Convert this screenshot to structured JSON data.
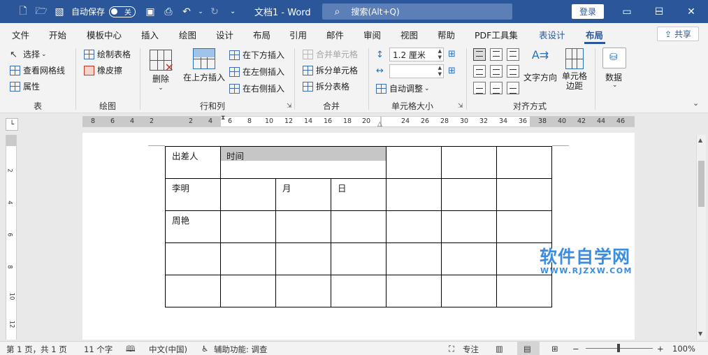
{
  "titlebar": {
    "autosave_label": "自动保存",
    "autosave_state": "关",
    "doc_title": "文档1  -  Word",
    "search_placeholder": "搜索(Alt+Q)",
    "login_label": "登录",
    "minimize": "─",
    "maximize": "☐",
    "close": "✕"
  },
  "tabs": [
    "文件",
    "开始",
    "模板中心",
    "插入",
    "绘图",
    "设计",
    "布局",
    "引用",
    "邮件",
    "审阅",
    "视图",
    "帮助",
    "PDF工具集",
    "表设计",
    "布局"
  ],
  "share_label": "共享",
  "ribbon": {
    "table_group": {
      "label": "表",
      "select": "选择",
      "view_gridlines": "查看网格线",
      "properties": "属性"
    },
    "draw_group": {
      "label": "绘图",
      "draw_table": "绘制表格",
      "eraser": "橡皮擦"
    },
    "rows_cols_group": {
      "label": "行和列",
      "delete": "删除",
      "insert_above": "在上方插入",
      "insert_below": "在下方插入",
      "insert_left": "在左侧插入",
      "insert_right": "在右侧插入"
    },
    "merge_group": {
      "label": "合并",
      "merge_cells": "合并单元格",
      "split_cells": "拆分单元格",
      "split_table": "拆分表格"
    },
    "cell_size_group": {
      "label": "单元格大小",
      "height_value": "1.2 厘米",
      "width_value": "",
      "autofit": "自动调整"
    },
    "align_group": {
      "label": "对齐方式",
      "text_direction": "文字方向",
      "cell_margins": "单元格\n边距"
    },
    "data_group": {
      "label": "数据"
    }
  },
  "ruler": {
    "numbers": [
      "8",
      "6",
      "4",
      "2",
      "2",
      "4",
      "6",
      "8",
      "10",
      "12",
      "14",
      "16",
      "18",
      "20",
      "24",
      "26",
      "28",
      "30",
      "32",
      "34",
      "36",
      "38",
      "40",
      "42",
      "44",
      "46"
    ],
    "vnumbers": [
      "2",
      "4",
      "6",
      "8",
      "10",
      "12"
    ]
  },
  "table": {
    "rows": [
      [
        "出差人",
        "时间",
        "",
        "",
        "",
        "",
        ""
      ],
      [
        "李明",
        "",
        "月",
        "日",
        "",
        "",
        ""
      ],
      [
        "周艳",
        "",
        "",
        "",
        "",
        "",
        ""
      ],
      [
        "",
        "",
        "",
        "",
        "",
        "",
        ""
      ],
      [
        "",
        "",
        "",
        "",
        "",
        "",
        ""
      ]
    ]
  },
  "watermark": {
    "cn": "软件自学网",
    "url": "WWW.RJZXW.COM"
  },
  "statusbar": {
    "page": "第 1 页，共 1 页",
    "words": "11 个字",
    "language": "中文(中国)",
    "accessibility": "辅助功能: 调查",
    "focus": "专注",
    "zoom": "100%"
  }
}
